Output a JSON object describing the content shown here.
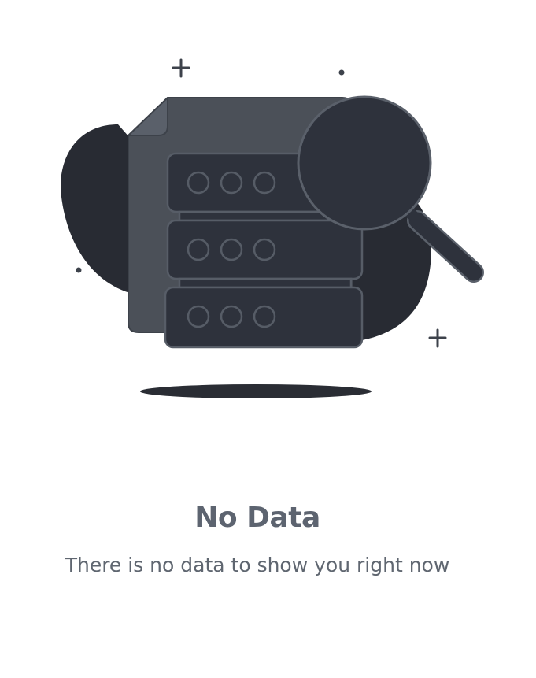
{
  "empty_state": {
    "title": "No Data",
    "message": "There is no data to show you right now",
    "illustration_icon": "database-search-icon"
  },
  "colors": {
    "background": "#ffffff",
    "text_title": "#5d6470",
    "text_body": "#5f6670",
    "blob": "#282b33",
    "document": "#4b5058",
    "server_block": "#2e323c",
    "outline": "#5a606a",
    "shadow": "#2a2d34"
  }
}
